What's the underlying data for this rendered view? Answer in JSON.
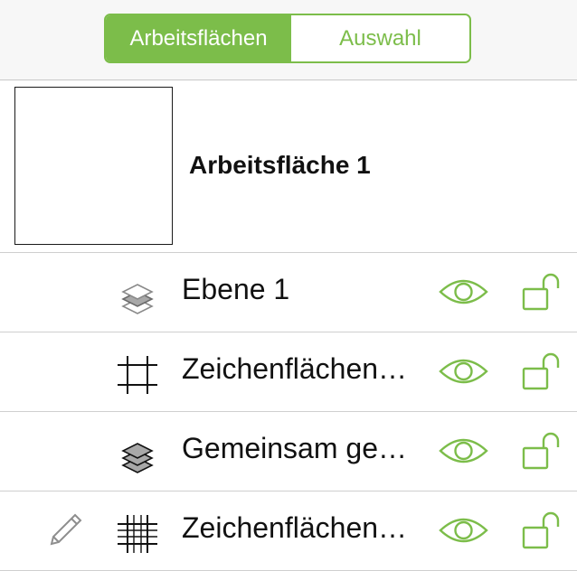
{
  "theme": {
    "accent": "#7cbd4a"
  },
  "segmented_control": {
    "artboards_label": "Arbeitsflächen",
    "selection_label": "Auswahl"
  },
  "artboard": {
    "title": "Arbeitsfläche 1"
  },
  "layers": [
    {
      "label": "Ebene 1",
      "icon": "layer-stack-icon",
      "visible_icon": "eye-icon",
      "lock_icon": "unlocked-padlock-icon"
    },
    {
      "label": "Zeichenflächen…",
      "icon": "canvas-crop-marks-icon",
      "visible_icon": "eye-icon",
      "lock_icon": "unlocked-padlock-icon"
    },
    {
      "label": "Gemeinsam ge…",
      "icon": "shared-layer-stack-icon",
      "visible_icon": "eye-icon",
      "lock_icon": "unlocked-padlock-icon"
    },
    {
      "label": "Zeichenflächen…",
      "icon": "grid-canvas-icon",
      "visible_icon": "eye-icon",
      "lock_icon": "unlocked-padlock-icon",
      "edit_icon": "pencil-icon"
    }
  ]
}
